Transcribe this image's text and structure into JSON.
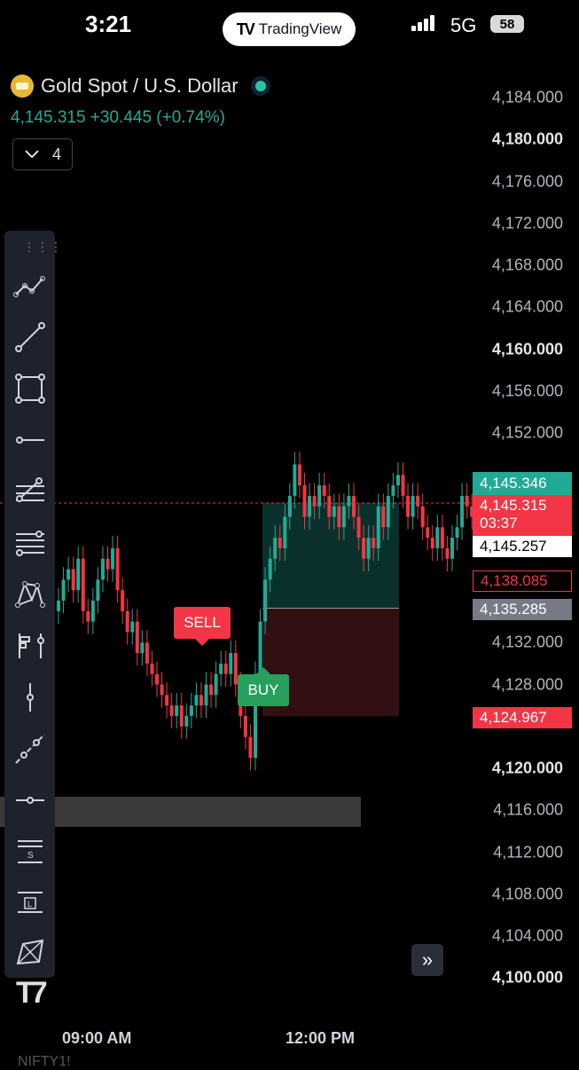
{
  "status_bar": {
    "time": "3:21",
    "app_name": "TradingView",
    "app_logo": "TV",
    "network": "5G",
    "battery": "58"
  },
  "symbol": {
    "name": "Gold Spot / U.S. Dollar",
    "price_line": "4,145.315  +30.445 (+0.74%)",
    "collapse_count": "4",
    "icon": "gold-bars-icon",
    "status_icon": "market-open-dot"
  },
  "price_axis": {
    "labels": [
      {
        "text": "4,184.000",
        "bold": false
      },
      {
        "text": "4,180.000",
        "bold": true
      },
      {
        "text": "4,176.000",
        "bold": false
      },
      {
        "text": "4,172.000",
        "bold": false
      },
      {
        "text": "4,168.000",
        "bold": false
      },
      {
        "text": "4,164.000",
        "bold": false
      },
      {
        "text": "4,160.000",
        "bold": true
      },
      {
        "text": "4,156.000",
        "bold": false
      },
      {
        "text": "4,152.000",
        "bold": false
      },
      {
        "text": "4,132.000",
        "bold": false
      },
      {
        "text": "4,128.000",
        "bold": false
      },
      {
        "text": "4,120.000",
        "bold": true
      },
      {
        "text": "4,116.000",
        "bold": false
      },
      {
        "text": "4,112.000",
        "bold": false
      },
      {
        "text": "4,108.000",
        "bold": false
      },
      {
        "text": "4,104.000",
        "bold": false
      },
      {
        "text": "4,100.000",
        "bold": true
      }
    ],
    "tags": {
      "green": "4,145.346",
      "red_price": "4,145.315",
      "red_countdown": "03:37",
      "white": "4,145.257",
      "outline_red": "4,138.085",
      "gray": "4,135.285",
      "red_bottom": "4,124.967"
    }
  },
  "signals": {
    "sell": "SELL",
    "buy": "BUY"
  },
  "time_axis": {
    "left": "09:00 AM",
    "right": "12:00 PM"
  },
  "footer_text": "NIFTY1!",
  "toolbar": {
    "tools": [
      "trend-line-multi-icon",
      "trend-line-icon",
      "rectangle-icon",
      "horizontal-ray-icon",
      "fib-retracement-icon",
      "parallel-lines-icon",
      "xabcd-pattern-icon",
      "long-short-position-icon",
      "vertical-line-icon",
      "extended-line-icon",
      "horizontal-line-icon",
      "support-line-icon",
      "long-line-icon",
      "polygon-icon"
    ]
  },
  "colors": {
    "up": "#22ab94",
    "down": "#f23645",
    "background": "#000000"
  },
  "chart_data": {
    "type": "candlestick",
    "ylim": [
      4100,
      4186
    ],
    "x_ticks": [
      "09:00 AM",
      "12:00 PM"
    ],
    "current_price": 4145.315,
    "position_entry": 4135.285,
    "take_profit": 4145.346,
    "stop_loss": 4124.967
  }
}
